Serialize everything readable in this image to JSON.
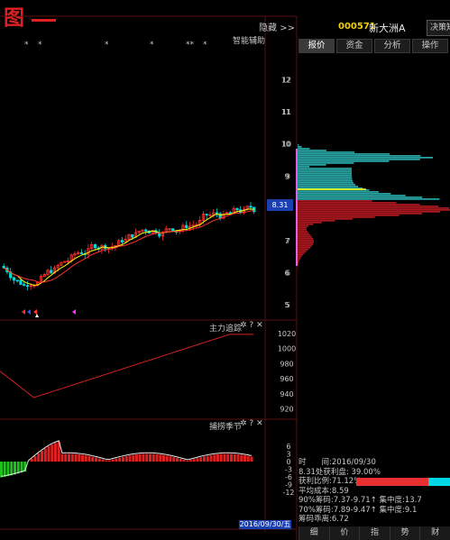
{
  "figure_label": "图",
  "hide_label": "隐藏 >>",
  "stock": {
    "code": "000571",
    "name": "新大洲A",
    "decision_label": "决策矩"
  },
  "side_tabs": [
    {
      "label": "报价"
    },
    {
      "label": "资金"
    },
    {
      "label": "分析"
    },
    {
      "label": "操作"
    }
  ],
  "main_chart": {
    "indicator_title": "智能辅助",
    "axis_ticks": [
      "12",
      "11",
      "10",
      "9",
      "8",
      "7",
      "6",
      "5"
    ],
    "current_price": "8.31",
    "star_markers": [
      "*",
      "*",
      "*",
      "*",
      "**",
      "*"
    ]
  },
  "panel1": {
    "title": "主力追踪",
    "axis_ticks": [
      "1020",
      "1000",
      "980",
      "960",
      "940",
      "920"
    ]
  },
  "panel2": {
    "title": "捕捞季节",
    "axis_ticks": [
      "6",
      "3",
      "0",
      "-3",
      "-6",
      "-9",
      "-12"
    ]
  },
  "panel_icons": {
    "settings": "✲",
    "help": "?",
    "close": "✕"
  },
  "date_label": "2016/09/30/五",
  "chip_info": {
    "time_label": "时　　间:2016/09/30",
    "profit_at_price": "8.31处获利盘: 39.00%",
    "profit_ratio": "获利比例:71.12%",
    "avg_cost": "平均成本:8.59",
    "chip90": "90%筹码:7.37-9.71↑ 集中度:13.7",
    "chip70": "70%筹码:7.89-9.47↑ 集中度:9.1",
    "chip_height": "筹码乖离:6.72"
  },
  "bottom_tabs": [
    {
      "label": "细"
    },
    {
      "label": "价"
    },
    {
      "label": "指"
    },
    {
      "label": "势"
    },
    {
      "label": "财"
    }
  ],
  "colors": {
    "up": "#ff3030",
    "down": "#00d8d8",
    "ma5": "#ffff00",
    "ma10": "#ff3030",
    "profit": "#b01820",
    "loss": "#2aa8a8",
    "accent": "#1a3fb0"
  }
}
